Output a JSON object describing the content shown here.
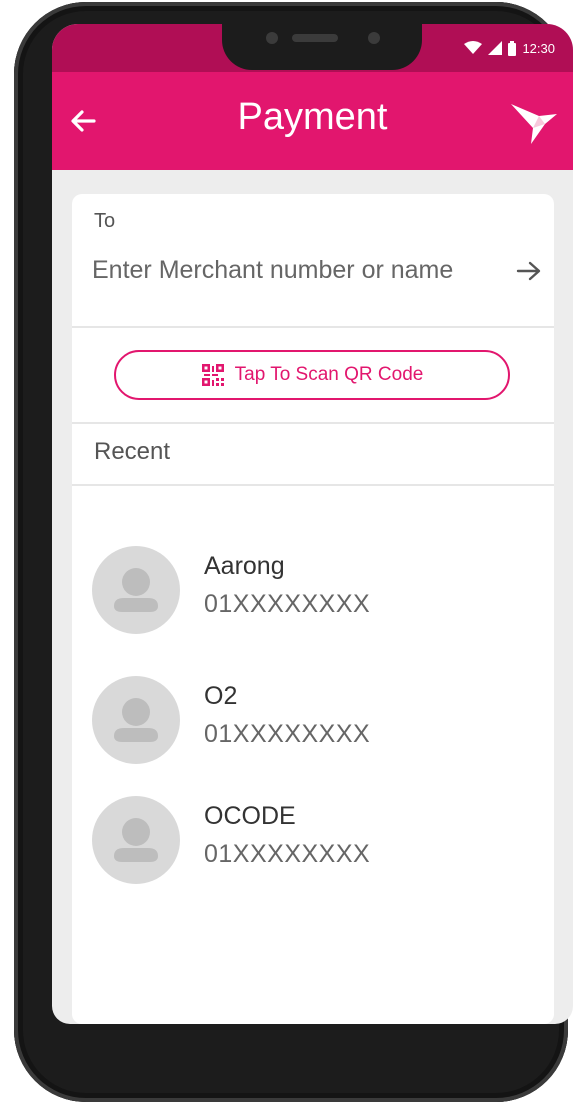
{
  "status_bar": {
    "time": "12:30",
    "icons": [
      "wifi-icon",
      "signal-icon",
      "battery-icon"
    ]
  },
  "header": {
    "title": "Payment",
    "back_icon": "back-arrow-icon",
    "logo_icon": "bird-logo-icon"
  },
  "to_section": {
    "label": "To",
    "placeholder": "Enter Merchant number or name",
    "submit_icon": "arrow-right-icon"
  },
  "scan": {
    "label": "Tap To Scan QR Code",
    "icon": "qr-code-icon"
  },
  "recent": {
    "label": "Recent",
    "contacts": [
      {
        "name": "Aarong",
        "number": "01XXXXXXXX"
      },
      {
        "name": "O2",
        "number": "01XXXXXXXX"
      },
      {
        "name": "OCODE",
        "number": "01XXXXXXXX"
      }
    ]
  },
  "colors": {
    "accent": "#e2166e",
    "status_bar": "#b00e55",
    "background": "#ededed",
    "avatar": "#d9d9d9",
    "avatar_icon": "#bdbdbd"
  }
}
